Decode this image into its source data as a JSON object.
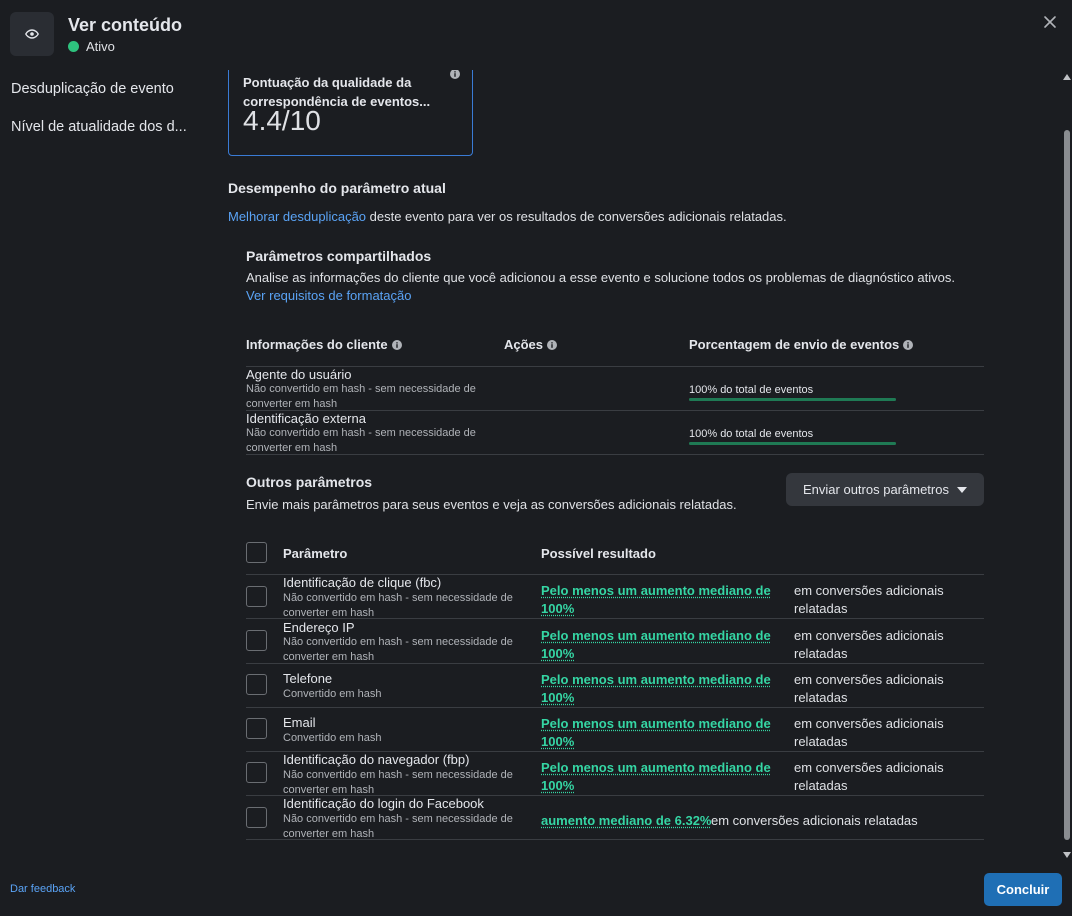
{
  "header": {
    "title": "Ver conteúdo",
    "status": "Ativo",
    "status_color": "#2ec27e"
  },
  "sidebar": {
    "items": [
      {
        "label": "Desduplicação de evento"
      },
      {
        "label": "Nível de atualidade dos d..."
      }
    ]
  },
  "score_card": {
    "label": "Pontuação da qualidade da correspondência de eventos...",
    "value": "4.4/10"
  },
  "performance": {
    "title": "Desempenho do parâmetro atual",
    "link": "Melhorar desduplicação",
    "text": " deste evento para ver os resultados de conversões adicionais relatadas."
  },
  "shared_params": {
    "title": "Parâmetros compartilhados",
    "desc": "Analise as informações do cliente que você adicionou a esse evento e solucione todos os problemas de diagnóstico ativos. ",
    "desc_link": "Ver requisitos de formatação",
    "columns": [
      "Informações do cliente",
      "Ações",
      "Porcentagem de envio de eventos"
    ],
    "rows": [
      {
        "name": "Agente do usuário",
        "sub": "Não convertido em hash - sem necessidade de converter em hash",
        "pct_text": "100% do total de eventos",
        "pct": 100
      },
      {
        "name": "Identificação externa",
        "sub": "Não convertido em hash - sem necessidade de converter em hash",
        "pct_text": "100% do total de eventos",
        "pct": 100
      }
    ]
  },
  "other_params": {
    "title": "Outros parâmetros",
    "desc": "Envie mais parâmetros para seus eventos e veja as conversões adicionais relatadas.",
    "dropdown_label": "Enviar outros parâmetros",
    "columns": [
      "Parâmetro",
      "Possível resultado"
    ],
    "rows": [
      {
        "name": "Identificação de clique (fbc)",
        "sub": "Não convertido em hash - sem necessidade de converter em hash",
        "result_link": "Pelo menos um aumento mediano de 100%",
        "result_suffix": "em conversões adicionais relatadas"
      },
      {
        "name": "Endereço IP",
        "sub": "Não convertido em hash - sem necessidade de converter em hash",
        "result_link": "Pelo menos um aumento mediano de 100%",
        "result_suffix": "em conversões adicionais relatadas"
      },
      {
        "name": "Telefone",
        "sub": "Convertido em hash",
        "result_link": "Pelo menos um aumento mediano de 100%",
        "result_suffix": "em conversões adicionais relatadas"
      },
      {
        "name": "Email",
        "sub": "Convertido em hash",
        "result_link": "Pelo menos um aumento mediano de 100%",
        "result_suffix": "em conversões adicionais relatadas"
      },
      {
        "name": "Identificação do navegador (fbp)",
        "sub": "Não convertido em hash - sem necessidade de converter em hash",
        "result_link": "Pelo menos um aumento mediano de 100%",
        "result_suffix": "em conversões adicionais relatadas"
      },
      {
        "name": "Identificação do login do Facebook",
        "sub": "Não convertido em hash - sem necessidade de converter em hash",
        "result_link": "aumento mediano de 6.32%",
        "result_suffix": "em conversões adicionais relatadas"
      }
    ]
  },
  "footer": {
    "feedback": "Dar feedback",
    "done": "Concluir"
  },
  "colors": {
    "accent": "#1f6fb5",
    "link": "#5aa3f5",
    "result": "#35d6a4",
    "background": "#1b1d21"
  },
  "icons": [
    "eye-icon",
    "close-icon",
    "info-icon",
    "chevron-down-icon"
  ]
}
